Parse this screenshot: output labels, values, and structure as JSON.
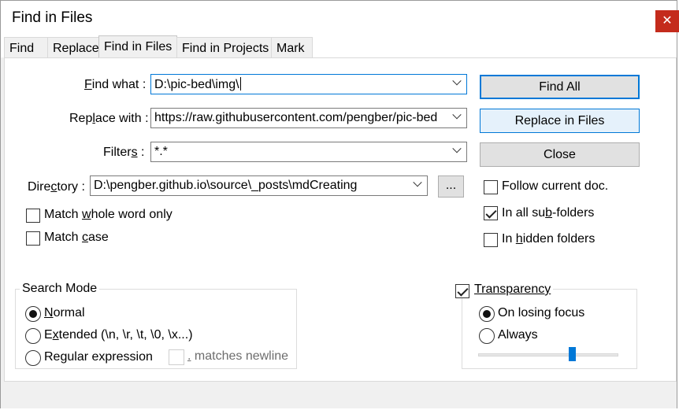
{
  "window": {
    "title": "Find in Files",
    "close_glyph": "✕"
  },
  "tabs": [
    {
      "label": "Find"
    },
    {
      "label": "Replace"
    },
    {
      "label": "Find in Files"
    },
    {
      "label": "Find in Projects"
    },
    {
      "label": "Mark"
    }
  ],
  "form": {
    "find_what": {
      "label_pre": "",
      "label_key": "F",
      "label_post": "ind what :",
      "value": "D:\\pic-bed\\img\\"
    },
    "replace_with": {
      "label_pre": "Rep",
      "label_key": "l",
      "label_post": "ace with :",
      "value": "https://raw.githubusercontent.com/pengber/pic-bed"
    },
    "filters": {
      "label_pre": "Filter",
      "label_key": "s",
      "label_post": " :",
      "value": "*.*"
    },
    "directory": {
      "label_pre": "Dire",
      "label_key": "c",
      "label_post": "tory :",
      "value": "D:\\pengber.github.io\\source\\_posts\\mdCreating",
      "browse_label": "..."
    }
  },
  "buttons": {
    "find_all": "Find All",
    "replace_in_files": "Replace in Files",
    "close": "Close"
  },
  "options_left": {
    "match_whole_word": {
      "pre": "Match ",
      "key": "w",
      "post": "hole word only",
      "checked": false
    },
    "match_case": {
      "pre": "Match ",
      "key": "c",
      "post": "ase",
      "checked": false
    }
  },
  "options_right": {
    "follow_current_doc": {
      "pre": "Follow current doc.",
      "key": "",
      "post": "",
      "checked": false
    },
    "in_all_subfolders": {
      "pre": "In all su",
      "key": "b",
      "post": "-folders",
      "checked": true
    },
    "in_hidden_folders": {
      "pre": "In ",
      "key": "h",
      "post": "idden folders",
      "checked": false
    }
  },
  "search_mode": {
    "title": "Search Mode",
    "normal": {
      "pre": "",
      "key": "N",
      "post": "ormal",
      "selected": true
    },
    "extended": {
      "pre": "E",
      "key": "x",
      "post": "tended (\\n, \\r, \\t, \\0, \\x...)",
      "selected": false
    },
    "regex": {
      "pre": "Re",
      "key": "g",
      "post": "ular expression",
      "selected": false
    },
    "matches_newline": {
      "key": ".",
      "post": " matches newline",
      "checked": false
    }
  },
  "transparency": {
    "title": "Transparency",
    "enabled": true,
    "on_losing_focus": {
      "label": "On losing focus",
      "selected": true
    },
    "always": {
      "label": "Always",
      "selected": false
    },
    "level": 0.68
  }
}
